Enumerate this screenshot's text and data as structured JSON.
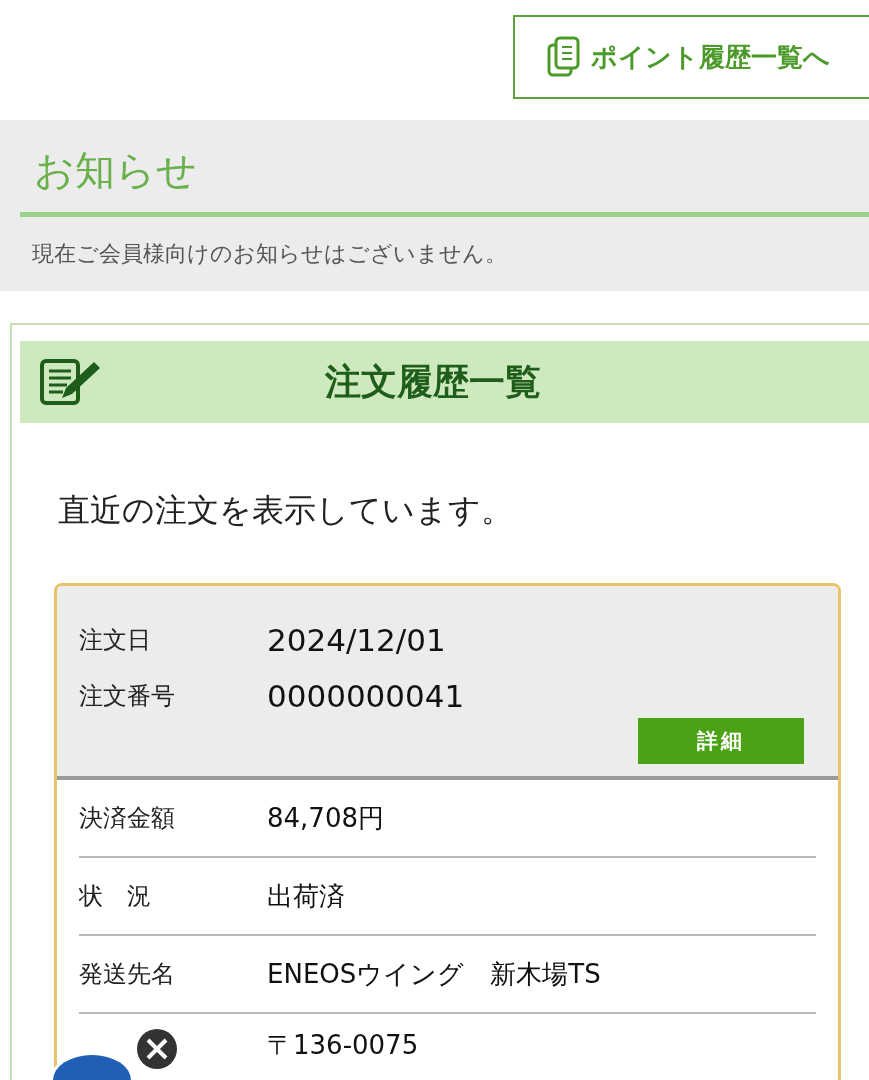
{
  "point_history_link": {
    "label": "ポイント履歴一覧へ"
  },
  "notice": {
    "title": "お知らせ",
    "message": "現在ご会員様向けのお知らせはございません。"
  },
  "order_history": {
    "title": "注文履歴一覧",
    "description": "直近の注文を表示しています。",
    "order": {
      "summary": [
        {
          "label": "注文日",
          "value": "2024/12/01"
        },
        {
          "label": "注文番号",
          "value": "0000000041"
        }
      ],
      "detail_button": "詳細",
      "rows": [
        {
          "label": "決済金額",
          "value": "84,708円"
        },
        {
          "label": "状　況",
          "value": "出荷済"
        },
        {
          "label": "発送先名",
          "value": "ENEOSウイング　新木場TS"
        },
        {
          "label": "",
          "value": "〒136-0075"
        }
      ]
    }
  }
}
